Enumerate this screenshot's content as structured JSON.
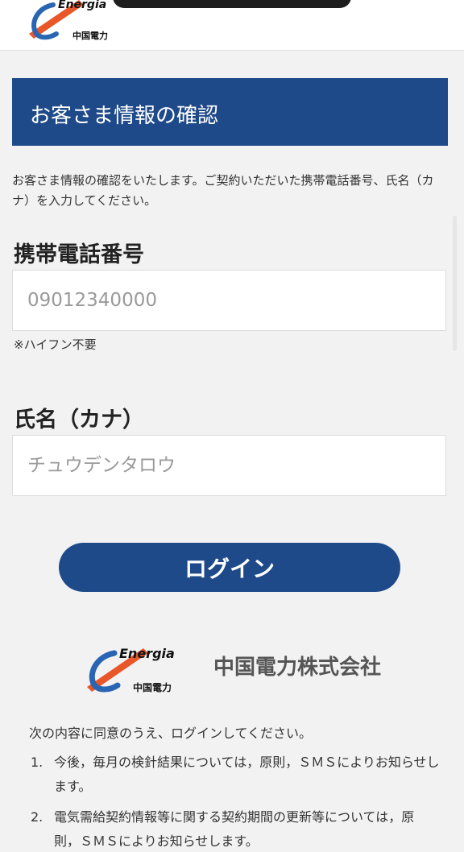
{
  "header": {
    "logo_brand": "Energia",
    "logo_company": "中国電力"
  },
  "page_title": "お客さま情報の確認",
  "intro_text": "お客さま情報の確認をいたします。ご契約いただいた携帯電話番号、氏名（カナ）を入力してください。",
  "phone": {
    "label": "携帯電話番号",
    "placeholder": "09012340000",
    "note": "※ハイフン不要"
  },
  "name": {
    "label": "氏名（カナ）",
    "placeholder": "チュウデンタロウ"
  },
  "login_button": "ログイン",
  "footer": {
    "logo_brand": "Energia",
    "logo_company": "中国電力",
    "company_name": "中国電力株式会社",
    "agree_intro": "次の内容に同意のうえ、ログインしてください。",
    "terms": [
      {
        "num": "1.",
        "text": "今後，毎月の検針結果については，原則，ＳＭＳによりお知らせします。"
      },
      {
        "num": "2.",
        "text": "電気需給契約情報等に関する契約期間の更新等については，原則，ＳＭＳによりお知らせします。"
      }
    ]
  },
  "colors": {
    "brand_blue": "#1f4a8a",
    "logo_orange": "#e8562a",
    "logo_blue": "#2a65b3"
  }
}
